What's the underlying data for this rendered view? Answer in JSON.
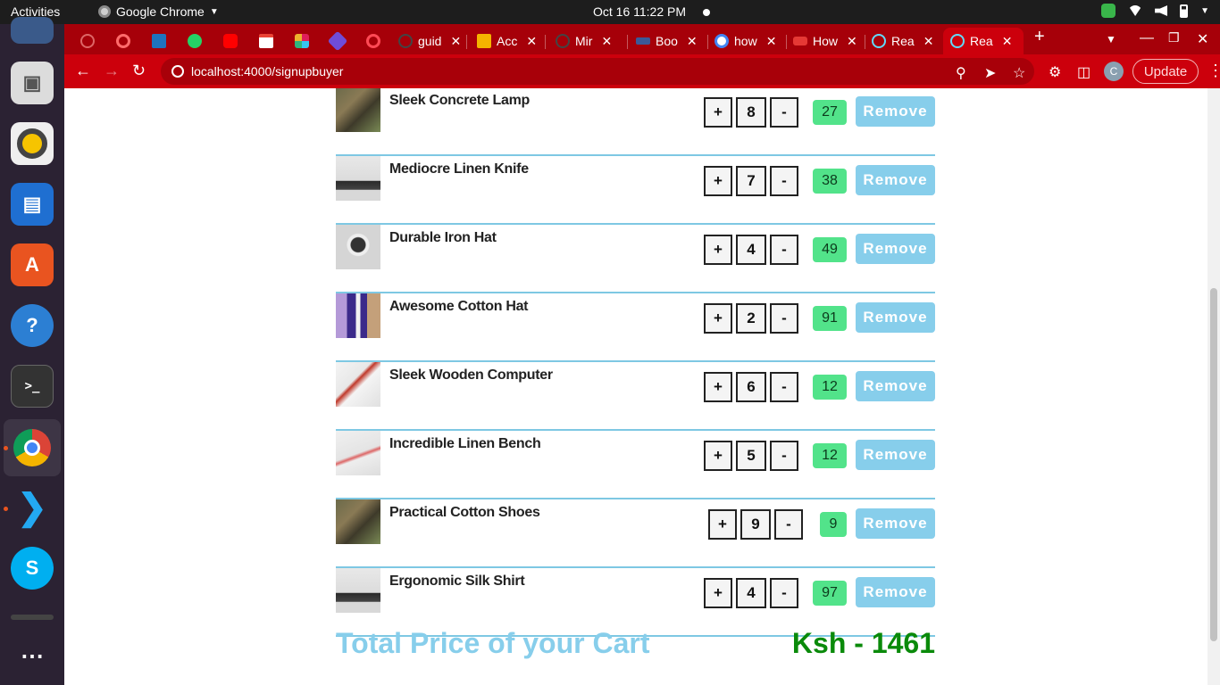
{
  "system": {
    "activities": "Activities",
    "app_name": "Google Chrome",
    "datetime": "Oct 16  11:22 PM"
  },
  "tabs": [
    {
      "label": "",
      "icon": "github-icon",
      "color": "#a60009"
    },
    {
      "label": "",
      "icon": "opera-icon",
      "color": "#ff1b2d"
    },
    {
      "label": "",
      "icon": "json-icon",
      "color": "#1e73be"
    },
    {
      "label": "",
      "icon": "whatsapp-icon",
      "color": "#25d366"
    },
    {
      "label": "",
      "icon": "youtube-icon",
      "color": "#ff0000"
    },
    {
      "label": "",
      "icon": "gmail-icon",
      "color": "#ea4335"
    },
    {
      "label": "",
      "icon": "slack-icon",
      "color": "#e8a33d"
    },
    {
      "label": "",
      "icon": "app-icon",
      "color": "#6f4cd8"
    },
    {
      "label": "",
      "icon": "globe-icon",
      "color": "#ff1b2d"
    },
    {
      "label": "guid",
      "icon": "github-icon",
      "color": "#333333"
    },
    {
      "label": "Acc",
      "icon": "slides-icon",
      "color": "#f4b400"
    },
    {
      "label": "Mir",
      "icon": "github-icon",
      "color": "#333333"
    },
    {
      "label": "Boo",
      "icon": "mdb-icon",
      "color": "#3b5998"
    },
    {
      "label": "how",
      "icon": "google-icon",
      "color": "#4285f4"
    },
    {
      "label": "How",
      "icon": "hub-icon",
      "color": "#e53935"
    },
    {
      "label": "Rea",
      "icon": "react-icon",
      "color": "#61dafb"
    },
    {
      "label": "Rea",
      "icon": "react-icon",
      "color": "#61dafb",
      "active": true
    }
  ],
  "address": {
    "url": "localhost:4000/signupbuyer",
    "profile_initial": "C",
    "update_label": "Update"
  },
  "cart": {
    "items": [
      {
        "name": "Sleek Concrete Lamp",
        "qty": "8",
        "price": "27",
        "img": "cat"
      },
      {
        "name": "Mediocre Linen Knife",
        "qty": "7",
        "price": "38",
        "img": "gadgets"
      },
      {
        "name": "Durable Iron Hat",
        "qty": "4",
        "price": "49",
        "img": "watch"
      },
      {
        "name": "Awesome Cotton Hat",
        "qty": "2",
        "price": "91",
        "img": "cosmetics"
      },
      {
        "name": "Sleek Wooden Computer",
        "qty": "6",
        "price": "12",
        "img": "products"
      },
      {
        "name": "Incredible Linen Bench",
        "qty": "5",
        "price": "12",
        "img": "flowers"
      },
      {
        "name": "Practical Cotton Shoes",
        "qty": "9",
        "price": "9",
        "img": "cat"
      },
      {
        "name": "Ergonomic Silk Shirt",
        "qty": "4",
        "price": "97",
        "img": "gadgets"
      }
    ],
    "plus_label": "+",
    "minus_label": "-",
    "remove_label": "Remove",
    "total_label": "Total Price of your Cart",
    "total_value": "Ksh - 1461"
  }
}
